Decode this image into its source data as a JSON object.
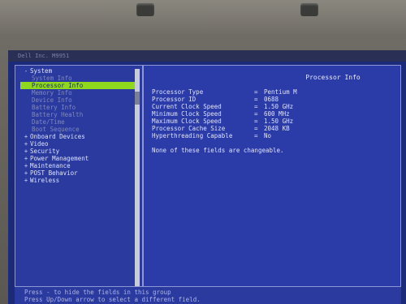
{
  "window": {
    "title": "Dell Inc. M9951"
  },
  "tree": [
    {
      "label": "System",
      "expander": "-",
      "level": "top"
    },
    {
      "label": "System Info",
      "level": "sub"
    },
    {
      "label": "Processor Info",
      "level": "sub",
      "active": true
    },
    {
      "label": "Memory Info",
      "level": "sub"
    },
    {
      "label": "Device Info",
      "level": "sub"
    },
    {
      "label": "Battery Info",
      "level": "sub"
    },
    {
      "label": "Battery Health",
      "level": "sub"
    },
    {
      "label": "Date/Time",
      "level": "sub"
    },
    {
      "label": "Boot Sequence",
      "level": "sub"
    },
    {
      "label": "Onboard Devices",
      "expander": "+",
      "level": "top"
    },
    {
      "label": "Video",
      "expander": "+",
      "level": "top"
    },
    {
      "label": "Security",
      "expander": "+",
      "level": "top"
    },
    {
      "label": "Power Management",
      "expander": "+",
      "level": "top"
    },
    {
      "label": "Maintenance",
      "expander": "+",
      "level": "top"
    },
    {
      "label": "POST Behavior",
      "expander": "+",
      "level": "top"
    },
    {
      "label": "Wireless",
      "expander": "+",
      "level": "top"
    }
  ],
  "panel": {
    "title": "Processor Info",
    "rows": [
      {
        "key": "Processor Type",
        "value": "Pentium M"
      },
      {
        "key": "Processor ID",
        "value": "0688"
      },
      {
        "key": "Current Clock Speed",
        "value": "1.50 GHz"
      },
      {
        "key": "Minimum Clock Speed",
        "value": "600 MHz"
      },
      {
        "key": "Maximum Clock Speed",
        "value": "1.50 GHz"
      },
      {
        "key": "Processor Cache Size",
        "value": "2048 KB"
      },
      {
        "key": "Hyperthreading Capable",
        "value": "No"
      }
    ],
    "note": "None of these fields are changeable."
  },
  "status": {
    "line1": "Press - to hide the fields in this group",
    "line2": "Press Up/Down arrow to select a different field."
  }
}
